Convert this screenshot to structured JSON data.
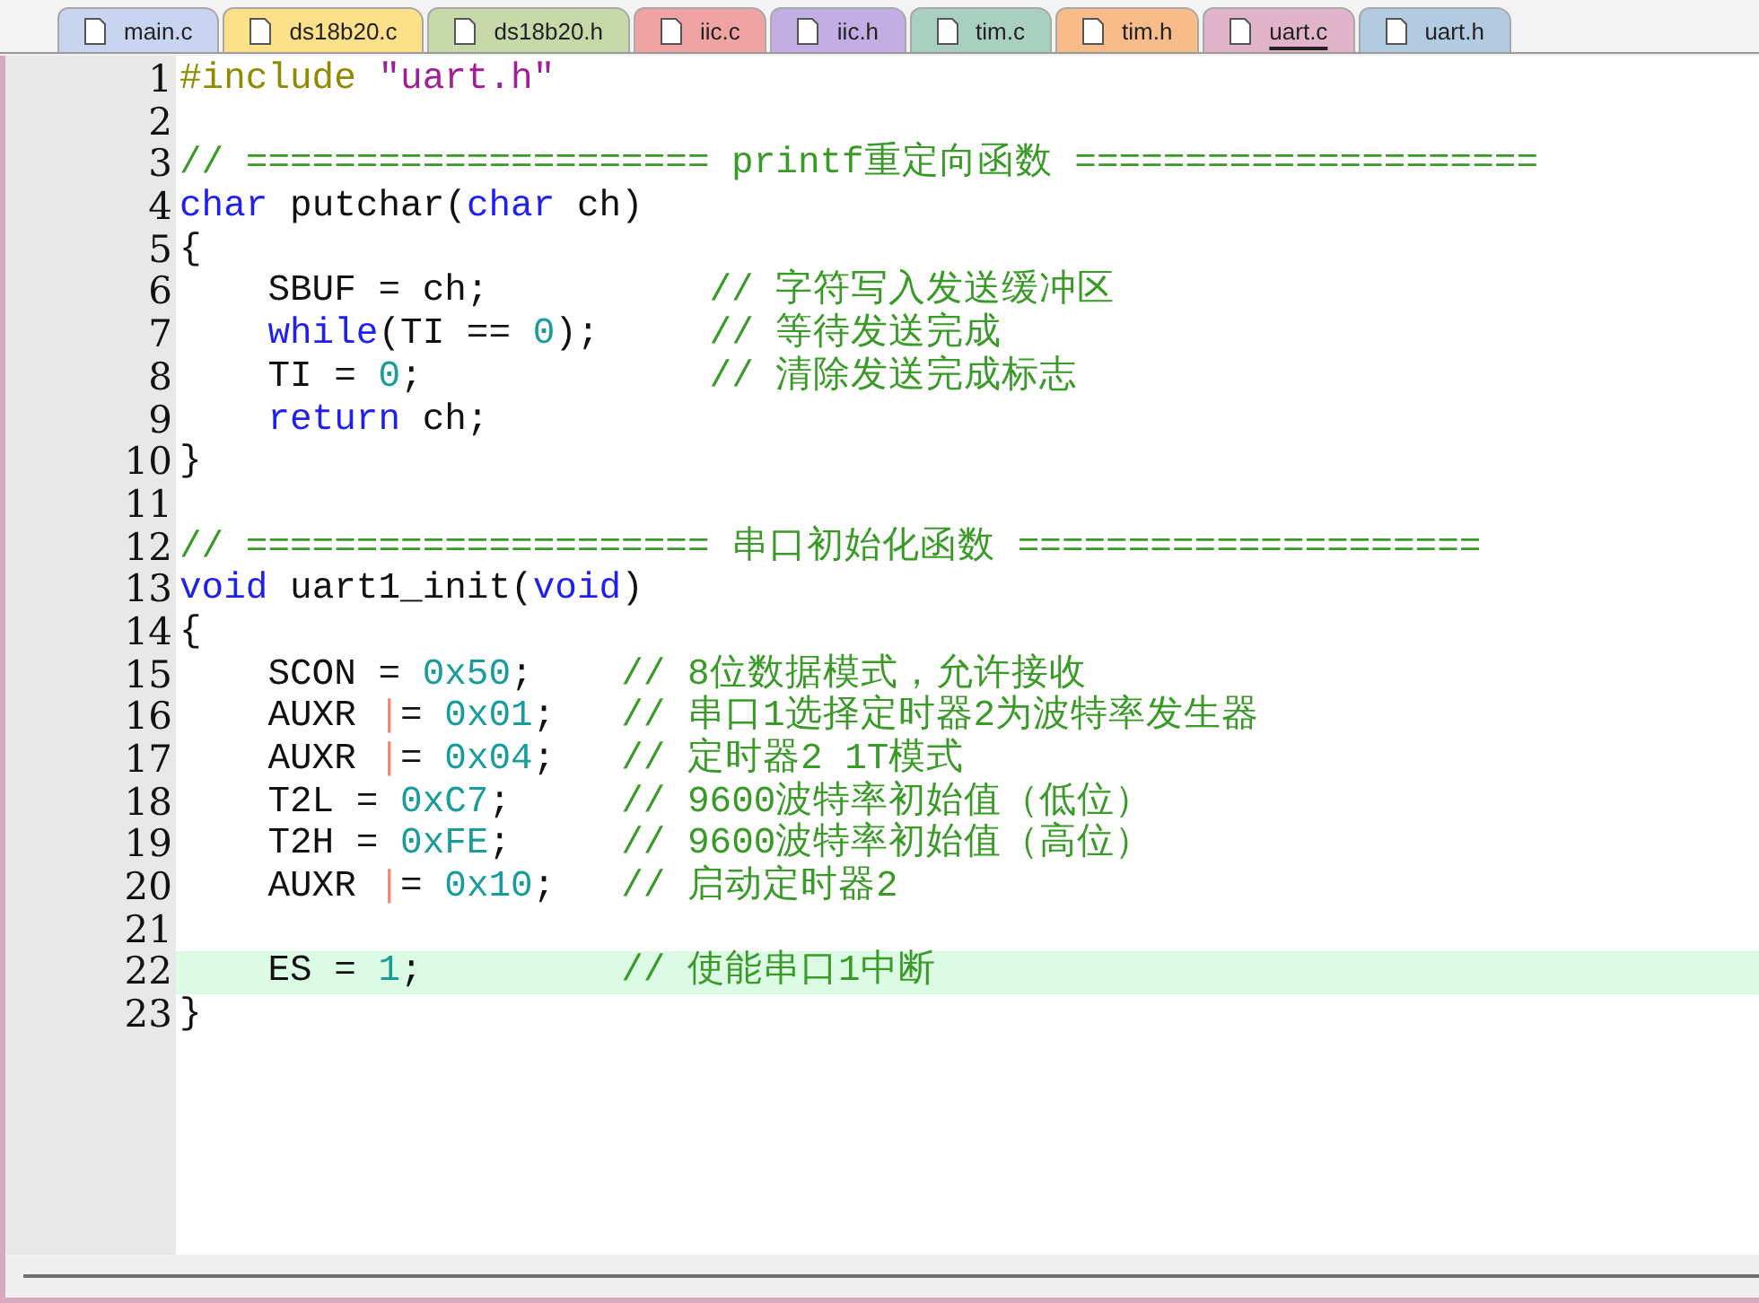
{
  "tabs": [
    {
      "label": "main.c",
      "color": "#c9d5f0",
      "selected": false
    },
    {
      "label": "ds18b20.c",
      "color": "#fde08a",
      "selected": false
    },
    {
      "label": "ds18b20.h",
      "color": "#c7d8a9",
      "selected": false
    },
    {
      "label": "iic.c",
      "color": "#f0a3a3",
      "selected": false
    },
    {
      "label": "iic.h",
      "color": "#c3aee3",
      "selected": false
    },
    {
      "label": "tim.c",
      "color": "#a9cfc0",
      "selected": false
    },
    {
      "label": "tim.h",
      "color": "#f8bb8a",
      "selected": false
    },
    {
      "label": "uart.c",
      "color": "#e2b4c9",
      "selected": true
    },
    {
      "label": "uart.h",
      "color": "#b2cbe0",
      "selected": false
    }
  ],
  "editor": {
    "lines": [
      {
        "number": "1",
        "current": false,
        "tokens": [
          {
            "kind": "preproc",
            "text": "#include "
          },
          {
            "kind": "string",
            "text": "\"uart.h\""
          }
        ]
      },
      {
        "number": "2",
        "current": false
      },
      {
        "number": "3",
        "current": false,
        "tokens": [
          {
            "kind": "comment",
            "text": "// ===================== printf重定向函数 ====================="
          }
        ]
      },
      {
        "number": "4",
        "current": false,
        "tokens": [
          {
            "kind": "keyword",
            "text": "char"
          },
          {
            "kind": "plain",
            "text": " putchar("
          },
          {
            "kind": "keyword",
            "text": "char"
          },
          {
            "kind": "plain",
            "text": " ch)"
          }
        ]
      },
      {
        "number": "5",
        "current": false,
        "tokens": [
          {
            "kind": "plain",
            "text": "{"
          }
        ]
      },
      {
        "number": "6",
        "current": false,
        "tokens": [
          {
            "kind": "plain",
            "text": "    SBUF = ch;          "
          },
          {
            "kind": "comment",
            "text": "// 字符写入发送缓冲区"
          }
        ]
      },
      {
        "number": "7",
        "current": false,
        "tokens": [
          {
            "kind": "keyword",
            "text": "    while"
          },
          {
            "kind": "plain",
            "text": "(TI == "
          },
          {
            "kind": "number",
            "text": "0"
          },
          {
            "kind": "plain",
            "text": ");     "
          },
          {
            "kind": "comment",
            "text": "// 等待发送完成"
          }
        ]
      },
      {
        "number": "8",
        "current": false,
        "tokens": [
          {
            "kind": "plain",
            "text": "    TI = "
          },
          {
            "kind": "number",
            "text": "0"
          },
          {
            "kind": "plain",
            "text": ";             "
          },
          {
            "kind": "comment",
            "text": "// 清除发送完成标志"
          }
        ]
      },
      {
        "number": "9",
        "current": false,
        "tokens": [
          {
            "kind": "keyword",
            "text": "    return"
          },
          {
            "kind": "plain",
            "text": " ch;"
          }
        ]
      },
      {
        "number": "10",
        "current": false,
        "tokens": [
          {
            "kind": "plain",
            "text": "}"
          }
        ]
      },
      {
        "number": "11",
        "current": false
      },
      {
        "number": "12",
        "current": false,
        "tokens": [
          {
            "kind": "comment",
            "text": "// ===================== 串口初始化函数 ====================="
          }
        ]
      },
      {
        "number": "13",
        "current": false,
        "tokens": [
          {
            "kind": "keyword",
            "text": "void"
          },
          {
            "kind": "plain",
            "text": " uart1_init("
          },
          {
            "kind": "keyword",
            "text": "void"
          },
          {
            "kind": "plain",
            "text": ")"
          }
        ]
      },
      {
        "number": "14",
        "current": false,
        "tokens": [
          {
            "kind": "plain",
            "text": "{"
          }
        ]
      },
      {
        "number": "15",
        "current": false,
        "tokens": [
          {
            "kind": "plain",
            "text": "    SCON = "
          },
          {
            "kind": "number",
            "text": "0x50"
          },
          {
            "kind": "plain",
            "text": ";    "
          },
          {
            "kind": "comment",
            "text": "// 8位数据模式，允许接收"
          }
        ]
      },
      {
        "number": "16",
        "current": false,
        "tokens": [
          {
            "kind": "plain",
            "text": "    AUXR "
          },
          {
            "kind": "operator",
            "text": "|"
          },
          {
            "kind": "plain",
            "text": "= "
          },
          {
            "kind": "number",
            "text": "0x01"
          },
          {
            "kind": "plain",
            "text": ";   "
          },
          {
            "kind": "comment",
            "text": "// 串口1选择定时器2为波特率发生器"
          }
        ]
      },
      {
        "number": "17",
        "current": false,
        "tokens": [
          {
            "kind": "plain",
            "text": "    AUXR "
          },
          {
            "kind": "operator",
            "text": "|"
          },
          {
            "kind": "plain",
            "text": "= "
          },
          {
            "kind": "number",
            "text": "0x04"
          },
          {
            "kind": "plain",
            "text": ";   "
          },
          {
            "kind": "comment",
            "text": "// 定时器2 1T模式"
          }
        ]
      },
      {
        "number": "18",
        "current": false,
        "tokens": [
          {
            "kind": "plain",
            "text": "    T2L = "
          },
          {
            "kind": "number",
            "text": "0xC7"
          },
          {
            "kind": "plain",
            "text": ";     "
          },
          {
            "kind": "comment",
            "text": "// 9600波特率初始值（低位）"
          }
        ]
      },
      {
        "number": "19",
        "current": false,
        "tokens": [
          {
            "kind": "plain",
            "text": "    T2H = "
          },
          {
            "kind": "number",
            "text": "0xFE"
          },
          {
            "kind": "plain",
            "text": ";     "
          },
          {
            "kind": "comment",
            "text": "// 9600波特率初始值（高位）"
          }
        ]
      },
      {
        "number": "20",
        "current": false,
        "tokens": [
          {
            "kind": "plain",
            "text": "    AUXR "
          },
          {
            "kind": "operator",
            "text": "|"
          },
          {
            "kind": "plain",
            "text": "= "
          },
          {
            "kind": "number",
            "text": "0x10"
          },
          {
            "kind": "plain",
            "text": ";   "
          },
          {
            "kind": "comment",
            "text": "// 启动定时器2"
          }
        ]
      },
      {
        "number": "21",
        "current": false
      },
      {
        "number": "22",
        "current": true,
        "tokens": [
          {
            "kind": "plain",
            "text": "    ES = "
          },
          {
            "kind": "number",
            "text": "1"
          },
          {
            "kind": "plain",
            "text": ";         "
          },
          {
            "kind": "comment",
            "text": "// 使能串口1中断"
          }
        ]
      },
      {
        "number": "23",
        "current": false,
        "tokens": [
          {
            "kind": "plain",
            "text": "}"
          }
        ]
      }
    ]
  }
}
